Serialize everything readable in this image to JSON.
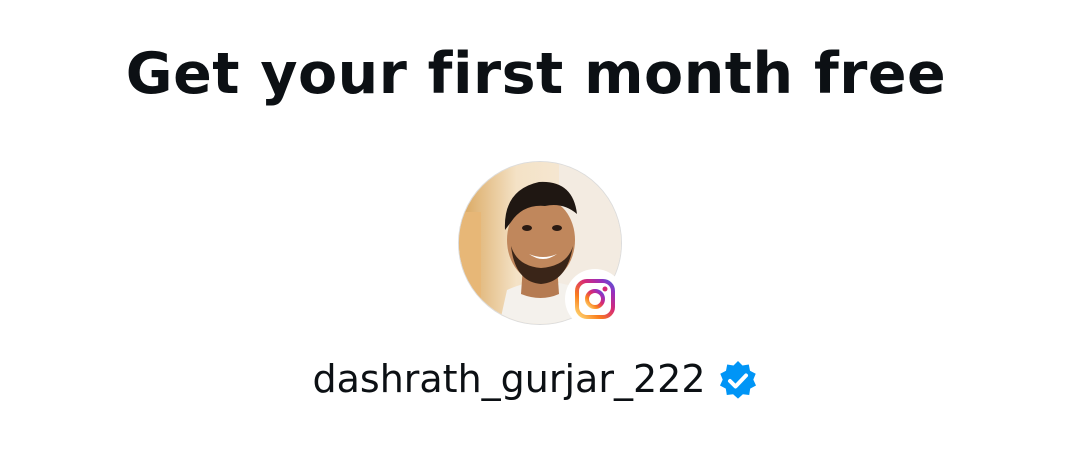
{
  "headline": "Get your first month free",
  "profile": {
    "username": "dashrath_gurjar_222",
    "verified": true,
    "avatar": "profile-photo",
    "platform_badge": "instagram-icon"
  },
  "colors": {
    "text": "#0c1014",
    "verified_badge": "#0095f6",
    "instagram_gradient": [
      "#feda75",
      "#fa7e1e",
      "#d62976",
      "#962fbf",
      "#4f5bd5"
    ]
  }
}
